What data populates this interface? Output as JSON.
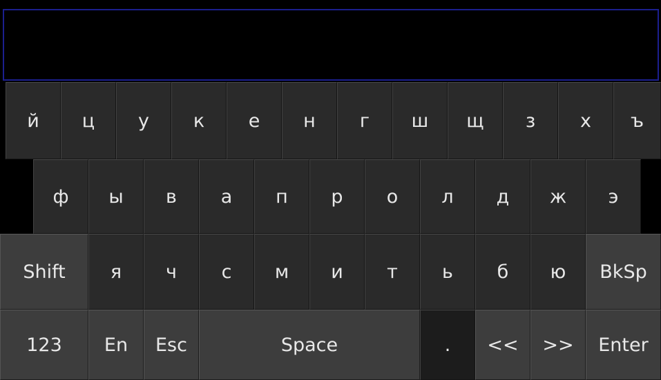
{
  "input": {
    "value": ""
  },
  "keyboard": {
    "row1": [
      "й",
      "ц",
      "у",
      "к",
      "е",
      "н",
      "г",
      "ш",
      "щ",
      "з",
      "х",
      "ъ"
    ],
    "row2": [
      "ф",
      "ы",
      "в",
      "а",
      "п",
      "р",
      "о",
      "л",
      "д",
      "ж",
      "э"
    ],
    "row3": {
      "shift": "Shift",
      "letters": [
        "я",
        "ч",
        "с",
        "м",
        "и",
        "т",
        "ь",
        "б",
        "ю"
      ],
      "backspace": "BkSp"
    },
    "row4": {
      "numbers": "123",
      "language": "En",
      "escape": "Esc",
      "space": "Space",
      "period": ".",
      "cursor_left": "<<",
      "cursor_right": ">>",
      "enter": "Enter"
    }
  },
  "colors": {
    "background": "#000000",
    "key": "#2a2a2a",
    "function_key": "#3d3d3d",
    "key_text": "#e8e8e8",
    "input_border": "#1b1f8f"
  }
}
